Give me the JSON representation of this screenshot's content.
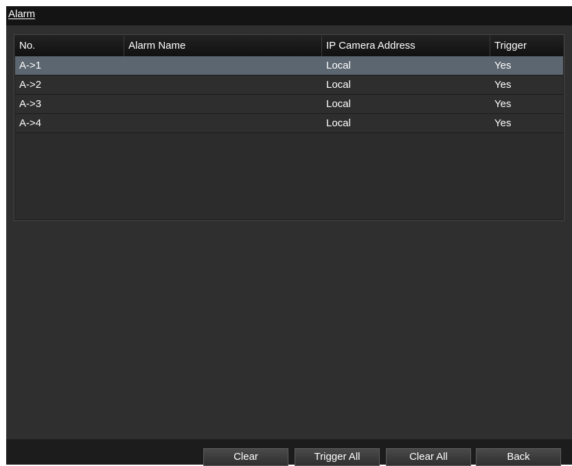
{
  "window": {
    "title": "Alarm"
  },
  "table": {
    "columns": [
      "No.",
      "Alarm Name",
      "IP Camera Address",
      "Trigger"
    ],
    "rows": [
      {
        "no": "A->1",
        "name": "",
        "ip": "Local",
        "trigger": "Yes"
      },
      {
        "no": "A->2",
        "name": "",
        "ip": "Local",
        "trigger": "Yes"
      },
      {
        "no": "A->3",
        "name": "",
        "ip": "Local",
        "trigger": "Yes"
      },
      {
        "no": "A->4",
        "name": "",
        "ip": "Local",
        "trigger": "Yes"
      }
    ],
    "selected_row": 0
  },
  "buttons": {
    "clear": "Clear",
    "trigger_all": "Trigger All",
    "clear_all": "Clear All",
    "back": "Back"
  },
  "colors": {
    "background": "#2f2f2f",
    "title_bar": "#141414",
    "selected_row": "#5c6670"
  }
}
